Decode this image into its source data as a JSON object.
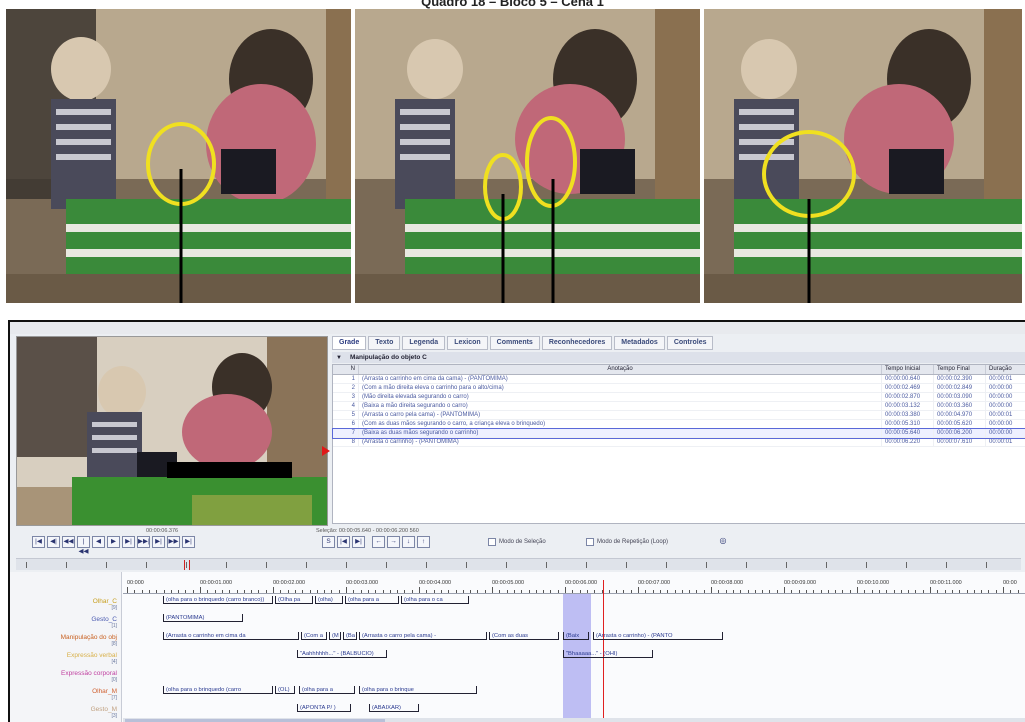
{
  "caption": "Quadro 18 – Bloco 5 – Cena 1",
  "frames": [
    {
      "name": "frame-1"
    },
    {
      "name": "frame-2"
    },
    {
      "name": "frame-3"
    }
  ],
  "elan": {
    "tabs": [
      "Grade",
      "Texto",
      "Legenda",
      "Lexicon",
      "Comments",
      "Reconhecedores",
      "Metadados",
      "Controles"
    ],
    "active_tab": "Grade",
    "tier_name": "Manipulação do objeto C",
    "grid": {
      "headers": [
        "N",
        "Anotação",
        "Tempo Inicial",
        "Tempo Final",
        "Duração"
      ],
      "rows": [
        {
          "n": "1",
          "ann": "(Arrasta o carrinho em cima da cama) - (PANTOMIMA)",
          "t1": "00:00:00.640",
          "t2": "00:00:02.390",
          "d": "00:00:01"
        },
        {
          "n": "2",
          "ann": "(Com a mão direita eleva o carrinho para o alto/cima)",
          "t1": "00:00:02.469",
          "t2": "00:00:02.849",
          "d": "00:00:00"
        },
        {
          "n": "3",
          "ann": "(Mão direita elevada segurando o carro)",
          "t1": "00:00:02.870",
          "t2": "00:00:03.090",
          "d": "00:00:00"
        },
        {
          "n": "4",
          "ann": "(Baixa a mão direita segurando o carro)",
          "t1": "00:00:03.132",
          "t2": "00:00:03.360",
          "d": "00:00:00"
        },
        {
          "n": "5",
          "ann": "(Arrasta o carro pela cama) - (PANTOMIMA)",
          "t1": "00:00:03.380",
          "t2": "00:00:04.970",
          "d": "00:00:01"
        },
        {
          "n": "6",
          "ann": "(Com as duas mãos segurando o carro, a criança eleva o brinquedo)",
          "t1": "00:00:05.310",
          "t2": "00:00:05.620",
          "d": "00:00:00"
        },
        {
          "n": "7",
          "ann": "(Baixa as duas mãos segurando o carrinho)",
          "t1": "00:00:05.640",
          "t2": "00:00:06.200",
          "d": "00:00:00"
        },
        {
          "n": "8",
          "ann": "(Arrasta o carrinho) - (PANTOMIMA)",
          "t1": "00:00:06.220",
          "t2": "00:00:07.610",
          "d": "00:00:01"
        }
      ],
      "selected_row": 6
    },
    "current_time": "00:00:06.376",
    "selection": "Seleção: 00:00:05.640 - 00:00:06.200  560",
    "buttons_left": [
      "|◀",
      "◀|",
      "◀◀",
      "|◀◀",
      "◀",
      "▶",
      "▶|",
      "▶▶|",
      "▶|",
      "▶▶",
      "▶|"
    ],
    "buttons_mid": [
      "S",
      "|◀",
      "▶|"
    ],
    "buttons_nav": [
      "←",
      "→",
      "↓",
      "↑"
    ],
    "chk_selection": "Modo de Seleção",
    "chk_loop": "Modo de Repetição (Loop)",
    "sound_icon": "speaker-icon",
    "ruler_labels": [
      "00:000",
      "00:00:01.000",
      "00:00:02.000",
      "00:00:03.000",
      "00:00:04.000",
      "00:00:05.000",
      "00:00:06.000",
      "00:00:07.000",
      "00:00:08.000",
      "00:00:09.000",
      "00:00:10.000",
      "00:00:11.000",
      "00:00"
    ],
    "tiers": [
      {
        "name": "Olhar_C",
        "sub": "[9]",
        "color": "#c8a020"
      },
      {
        "name": "Gesto_C",
        "sub": "[1]",
        "color": "#4a5ab0"
      },
      {
        "name": "Manipulação do obj",
        "sub": "[8]",
        "color": "#c86020"
      },
      {
        "name": "Expressão verbal",
        "sub": "[4]",
        "color": "#d8b048"
      },
      {
        "name": "Expressão corporal",
        "sub": "[0]",
        "color": "#c040a0"
      },
      {
        "name": "Olhar_M",
        "sub": "[7]",
        "color": "#d06030"
      },
      {
        "name": "Gesto_M",
        "sub": "[3]",
        "color": "#c0a080"
      }
    ],
    "segments": {
      "olhar_c": [
        "(olha para o brinquedo (carro branco))",
        "(Olha pa",
        "(olha)",
        "(olha para a",
        "(olha para o ca"
      ],
      "gesto_c": [
        "(PANTOMIMA)"
      ],
      "manip": [
        "(Arrasta o carrinho em cima da",
        "(Com a",
        "(M",
        "(Ba",
        "(Arrasta o carro pela cama) -",
        "(Com as duas",
        "(Baix",
        "(Arrasta o carrinho) - (PANTO"
      ],
      "verbal": [
        "\"Aahhhhhh...\" - (BALBUCIO)",
        "\"Bhaaaaa...\" - (OHI)"
      ],
      "olhar_m": [
        "(olha para o brinquedo (carro",
        "(OL)",
        "(olha para a",
        "(olha para o brinque"
      ],
      "gesto_m": [
        "(APONTA P/ )",
        "(ABAIXAR)"
      ]
    }
  }
}
